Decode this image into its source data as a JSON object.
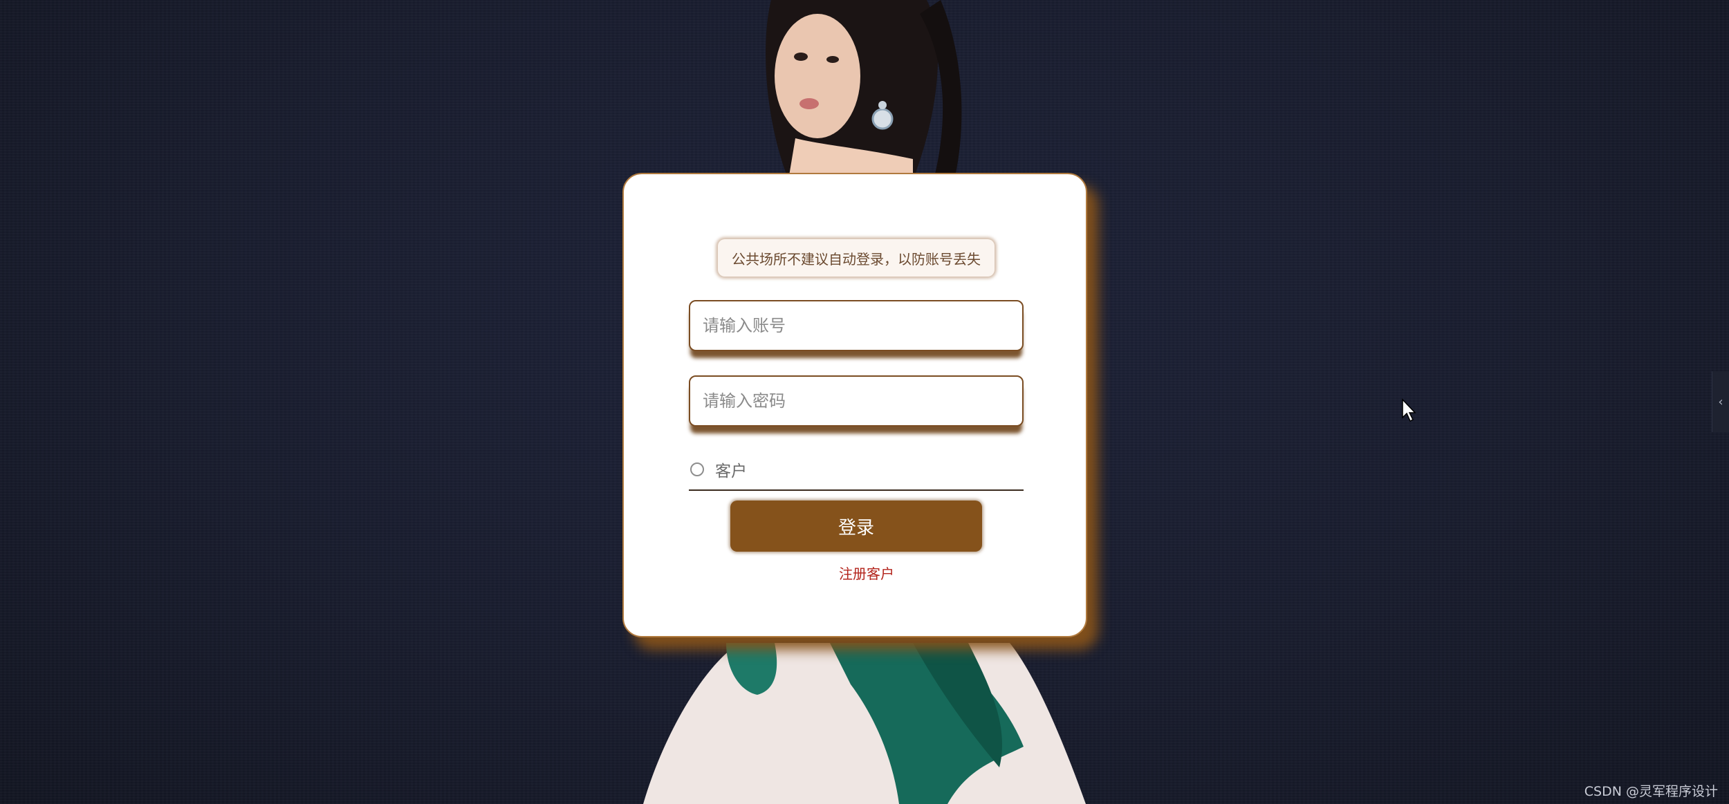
{
  "login": {
    "notice": "公共场所不建议自动登录，以防账号丢失",
    "account_placeholder": "请输入账号",
    "password_placeholder": "请输入密码",
    "role_option": "客户",
    "login_button": "登录",
    "register_link": "注册客户"
  },
  "side_tab": {
    "icon": "chevron-left-icon"
  },
  "watermark": "CSDN @灵军程序设计",
  "colors": {
    "card_shadow": "#85521b",
    "button": "#85521b",
    "register_link": "#b3231b",
    "background": "#181c2e"
  }
}
